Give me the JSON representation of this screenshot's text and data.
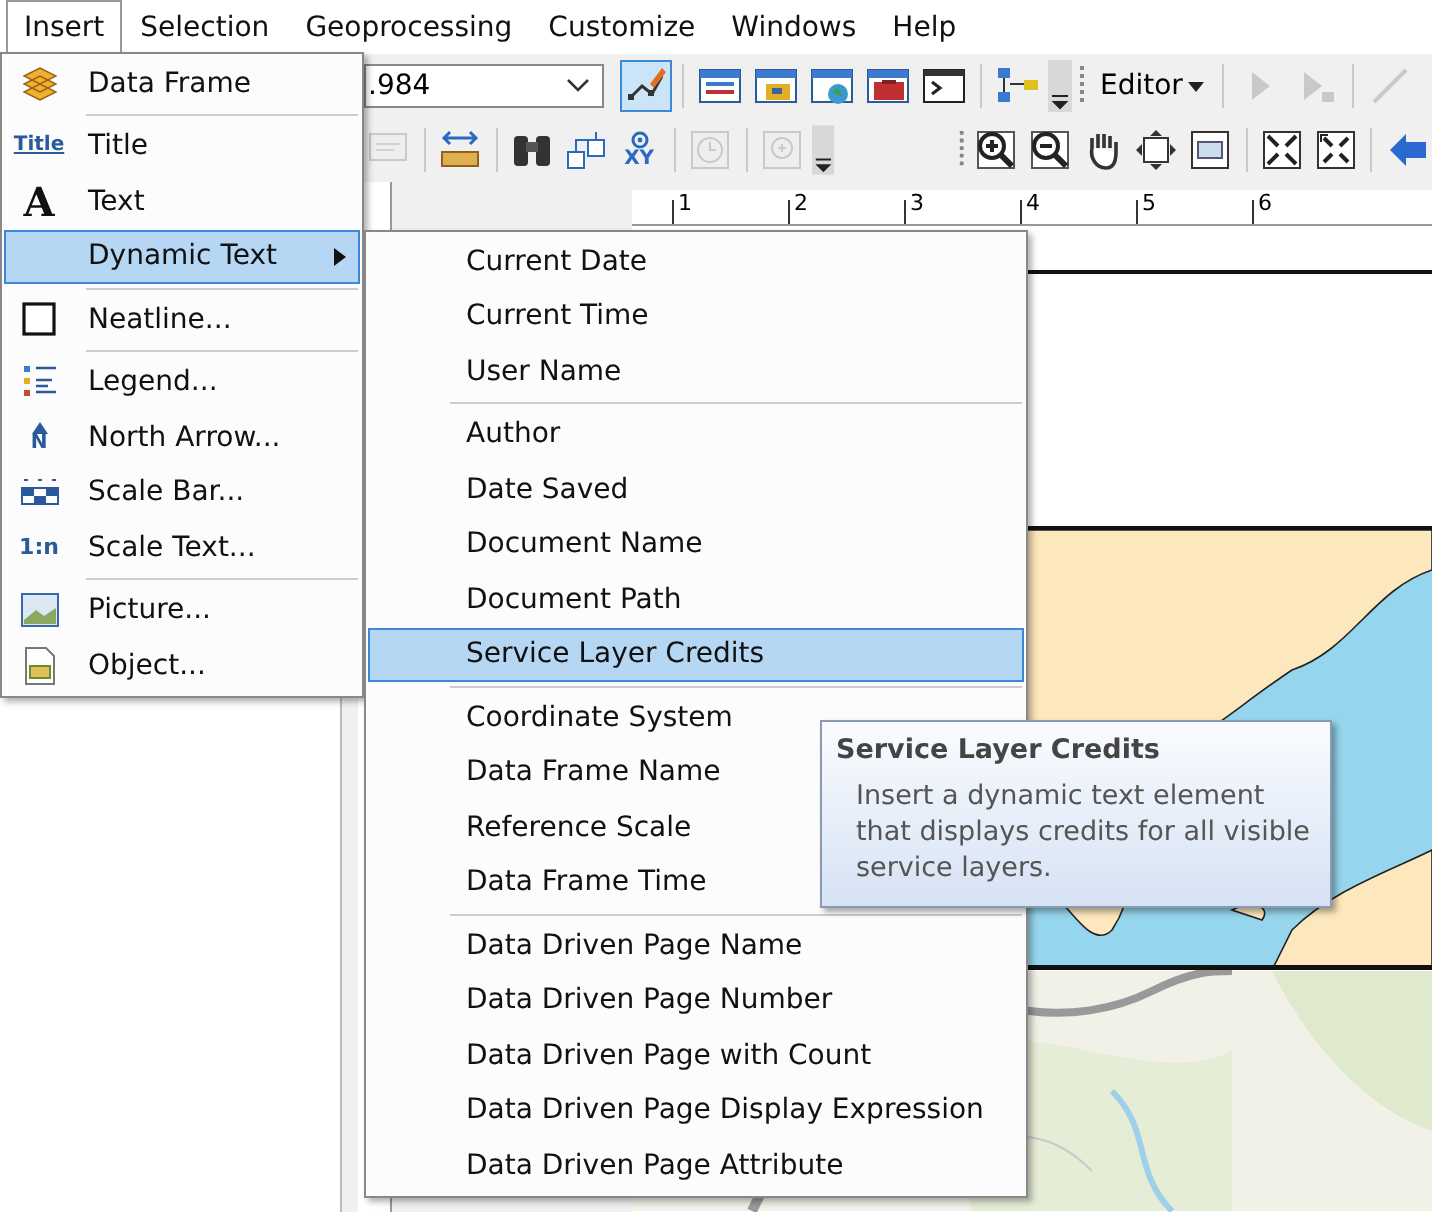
{
  "menubar": [
    {
      "label": "Insert",
      "selected": true
    },
    {
      "label": "Selection",
      "selected": false
    },
    {
      "label": "Geoprocessing",
      "selected": false
    },
    {
      "label": "Customize",
      "selected": false
    },
    {
      "label": "Windows",
      "selected": false
    },
    {
      "label": "Help",
      "selected": false
    }
  ],
  "toolbar_1": [
    {
      "kind": "combo",
      "value": ".984"
    },
    {
      "kind": "tool",
      "selected": true,
      "disabled": false
    },
    {
      "kind": "sep"
    },
    {
      "kind": "tool",
      "selected": false,
      "disabled": false
    },
    {
      "kind": "tool",
      "selected": false,
      "disabled": false
    },
    {
      "kind": "tool",
      "selected": false,
      "disabled": false
    },
    {
      "kind": "tool",
      "selected": false,
      "disabled": false
    },
    {
      "kind": "tool",
      "selected": false,
      "disabled": false
    },
    {
      "kind": "sep"
    },
    {
      "kind": "tool",
      "selected": false,
      "disabled": false
    },
    {
      "kind": "overflow"
    },
    {
      "kind": "grip"
    },
    {
      "kind": "menu",
      "label": "Editor"
    },
    {
      "kind": "sep"
    },
    {
      "kind": "tool",
      "selected": false,
      "disabled": true
    },
    {
      "kind": "tool",
      "selected": false,
      "disabled": true
    },
    {
      "kind": "sep"
    },
    {
      "kind": "tool",
      "selected": false,
      "disabled": true
    }
  ],
  "toolbar_2": [
    {
      "kind": "tool",
      "selected": false,
      "disabled": true
    },
    {
      "kind": "sep"
    },
    {
      "kind": "tool",
      "selected": false,
      "disabled": false
    },
    {
      "kind": "sep"
    },
    {
      "kind": "tool",
      "selected": false,
      "disabled": false
    },
    {
      "kind": "tool",
      "selected": false,
      "disabled": false
    },
    {
      "kind": "tool",
      "selected": false,
      "disabled": false,
      "glyph": "XY"
    },
    {
      "kind": "sep"
    },
    {
      "kind": "tool",
      "selected": false,
      "disabled": true
    },
    {
      "kind": "sep"
    },
    {
      "kind": "tool",
      "selected": false,
      "disabled": true
    },
    {
      "kind": "overflow"
    },
    {
      "kind": "gap"
    },
    {
      "kind": "grip"
    },
    {
      "kind": "tool",
      "selected": false,
      "disabled": false
    },
    {
      "kind": "tool",
      "selected": false,
      "disabled": false
    },
    {
      "kind": "tool",
      "selected": false,
      "disabled": false
    },
    {
      "kind": "tool",
      "selected": false,
      "disabled": false
    },
    {
      "kind": "tool",
      "selected": false,
      "disabled": false
    },
    {
      "kind": "sep"
    },
    {
      "kind": "tool",
      "selected": false,
      "disabled": false
    },
    {
      "kind": "tool",
      "selected": false,
      "disabled": false
    },
    {
      "kind": "sep"
    },
    {
      "kind": "tool",
      "selected": false,
      "disabled": false
    }
  ],
  "ruler": {
    "labels": [
      "1",
      "2",
      "3",
      "4",
      "5",
      "6"
    ]
  },
  "insert_menu": {
    "groups": [
      [
        {
          "label": "Data Frame",
          "selected": false,
          "submenu": false
        }
      ],
      [
        {
          "label": "Title",
          "selected": false,
          "submenu": false,
          "glyph": "Title"
        },
        {
          "label": "Text",
          "selected": false,
          "submenu": false,
          "glyph": "A"
        },
        {
          "label": "Dynamic Text",
          "selected": true,
          "submenu": true
        }
      ],
      [
        {
          "label": "Neatline...",
          "selected": false,
          "submenu": false
        }
      ],
      [
        {
          "label": "Legend...",
          "selected": false,
          "submenu": false
        },
        {
          "label": "North Arrow...",
          "selected": false,
          "submenu": false,
          "glyph": "N"
        },
        {
          "label": "Scale Bar...",
          "selected": false,
          "submenu": false
        },
        {
          "label": "Scale Text...",
          "selected": false,
          "submenu": false,
          "glyph": "1:n"
        }
      ],
      [
        {
          "label": "Picture...",
          "selected": false,
          "submenu": false
        },
        {
          "label": "Object...",
          "selected": false,
          "submenu": false
        }
      ]
    ]
  },
  "dynamic_text_menu": {
    "groups": [
      [
        {
          "label": "Current Date",
          "selected": false
        },
        {
          "label": "Current Time",
          "selected": false
        },
        {
          "label": "User Name",
          "selected": false
        }
      ],
      [
        {
          "label": "Author",
          "selected": false
        },
        {
          "label": "Date Saved",
          "selected": false
        },
        {
          "label": "Document Name",
          "selected": false
        },
        {
          "label": "Document Path",
          "selected": false
        },
        {
          "label": "Service Layer Credits",
          "selected": true
        }
      ],
      [
        {
          "label": "Coordinate System",
          "selected": false
        },
        {
          "label": "Data Frame Name",
          "selected": false
        },
        {
          "label": "Reference Scale",
          "selected": false
        },
        {
          "label": "Data Frame Time",
          "selected": false
        }
      ],
      [
        {
          "label": "Data Driven Page Name",
          "selected": false
        },
        {
          "label": "Data Driven Page Number",
          "selected": false
        },
        {
          "label": "Data Driven Page with Count",
          "selected": false
        },
        {
          "label": "Data Driven Page Display Expression",
          "selected": false
        },
        {
          "label": "Data Driven Page Attribute",
          "selected": false
        }
      ]
    ]
  },
  "tooltip": {
    "title": "Service Layer Credits",
    "text": "Insert a dynamic text element that displays credits for all visible service layers."
  }
}
